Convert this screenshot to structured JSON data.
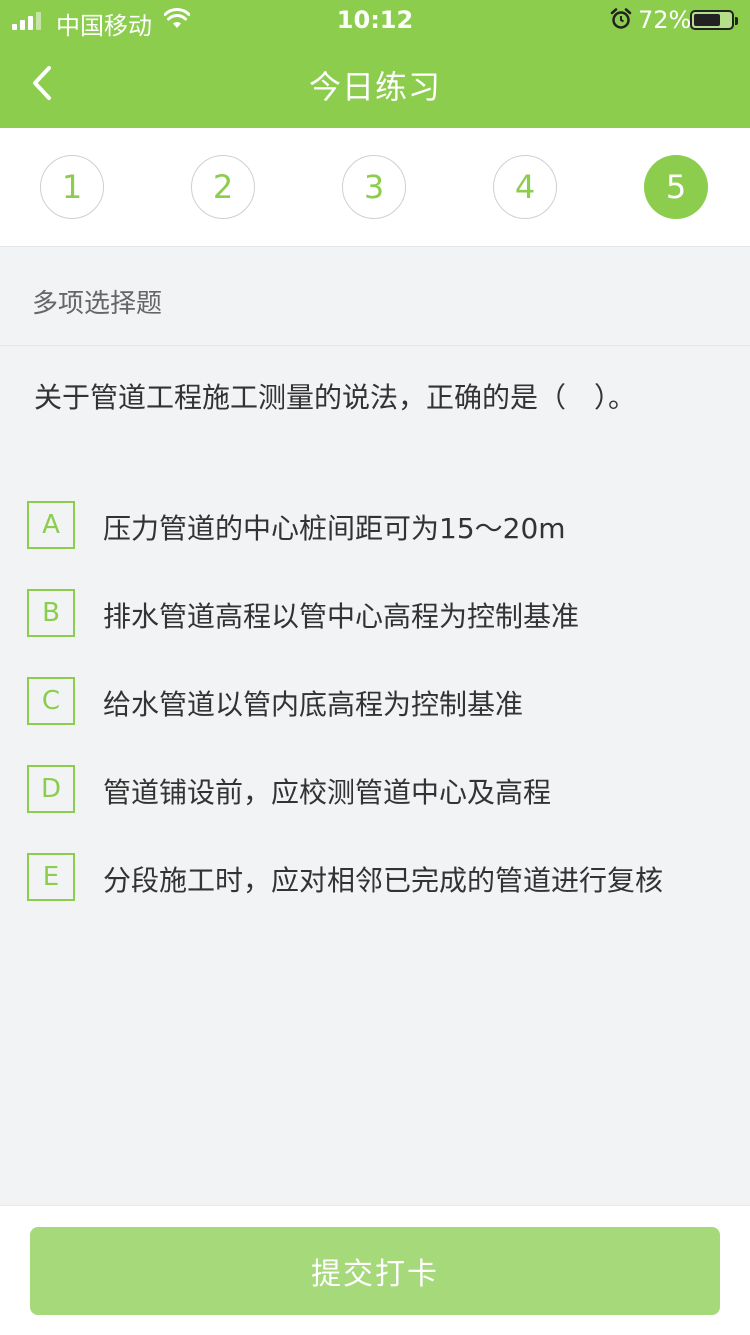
{
  "status_bar": {
    "carrier": "中国移动",
    "time": "10:12",
    "battery": "72%",
    "battery_level": 0.72
  },
  "nav": {
    "title": "今日练习"
  },
  "steps": [
    "1",
    "2",
    "3",
    "4",
    "5"
  ],
  "active_step": 5,
  "section_label": "多项选择题",
  "question": "关于管道工程施工测量的说法，正确的是（　）。",
  "options": [
    {
      "letter": "A",
      "text": "压力管道的中心桩间距可为15～20m"
    },
    {
      "letter": "B",
      "text": "排水管道高程以管中心高程为控制基准"
    },
    {
      "letter": "C",
      "text": "给水管道以管内底高程为控制基准"
    },
    {
      "letter": "D",
      "text": "管道铺设前，应校测管道中心及高程"
    },
    {
      "letter": "E",
      "text": "分段施工时，应对相邻已完成的管道进行复核"
    }
  ],
  "submit_label": "提交打卡",
  "colors": {
    "accent": "#8ccd4e",
    "button_disabled": "#a5d979",
    "background": "#f2f3f5"
  }
}
